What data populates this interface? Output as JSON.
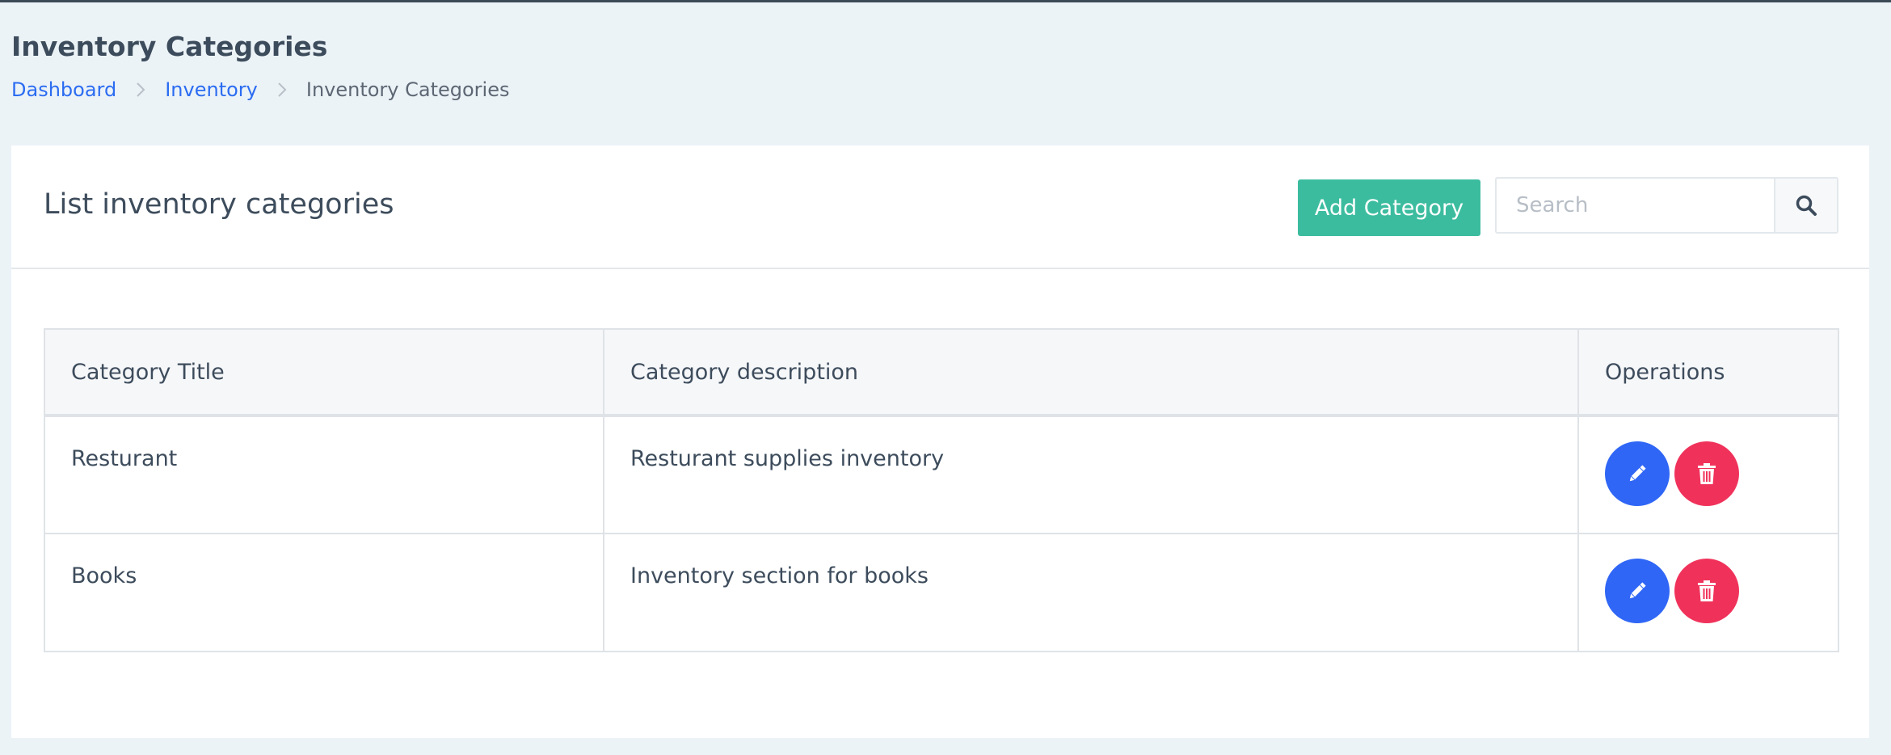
{
  "page": {
    "title": "Inventory Categories",
    "breadcrumb": [
      {
        "label": "Dashboard",
        "link": true
      },
      {
        "label": "Inventory",
        "link": true
      },
      {
        "label": "Inventory Categories",
        "link": false
      }
    ]
  },
  "card": {
    "title": "List inventory categories",
    "add_button_label": "Add Category",
    "search": {
      "placeholder": "Search",
      "value": ""
    }
  },
  "table": {
    "headers": [
      "Category Title",
      "Category description",
      "Operations"
    ],
    "rows": [
      {
        "title": "Resturant",
        "description": "Resturant supplies inventory"
      },
      {
        "title": "Books",
        "description": "Inventory section for books"
      }
    ]
  },
  "colors": {
    "background": "#ecf3f7",
    "link": "#2b6cf1",
    "primary_action": "#3cbc9f",
    "edit": "#2f66f5",
    "delete": "#f0325b"
  },
  "icons": {
    "breadcrumb_separator": "chevron-right-icon",
    "search": "search-icon",
    "edit": "pencil-icon",
    "delete": "trash-icon"
  }
}
